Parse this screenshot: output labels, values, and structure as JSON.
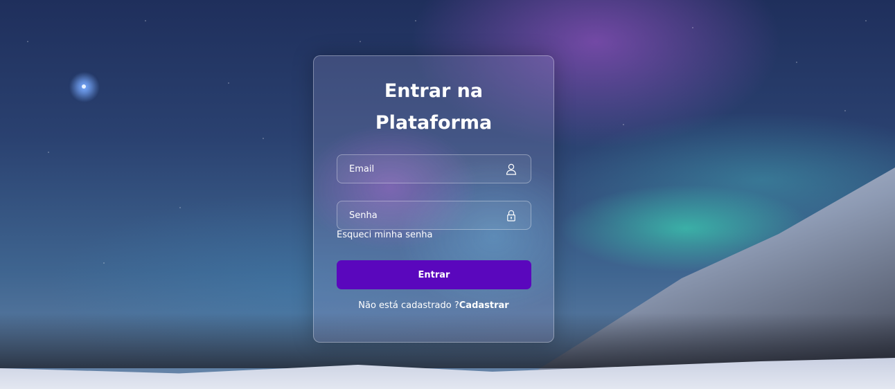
{
  "login": {
    "title_line1": "Entrar na",
    "title_line2": "Plataforma",
    "email": {
      "placeholder": "Email",
      "value": "",
      "icon": "user-icon"
    },
    "password": {
      "placeholder": "Senha",
      "value": "",
      "icon": "lock-icon"
    },
    "forgot_link": "Esqueci minha senha",
    "submit_label": "Entrar",
    "signup_prompt": "Não está cadastrado ?",
    "signup_link": "Cadastrar"
  },
  "colors": {
    "button": "#5a07bd",
    "text": "#ffffff"
  }
}
